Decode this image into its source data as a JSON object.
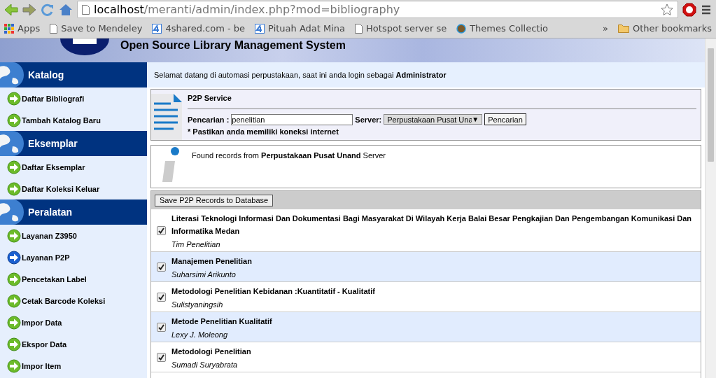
{
  "browser": {
    "url": {
      "host": "localhost",
      "path": "/meranti/admin/index.php?mod=bibliography"
    },
    "bookmarks": [
      {
        "label": "Apps",
        "kind": "apps"
      },
      {
        "label": "Save to Mendeley",
        "kind": "page"
      },
      {
        "label": "4shared.com - be",
        "kind": "four"
      },
      {
        "label": "Pituah Adat Mina",
        "kind": "four"
      },
      {
        "label": "Hotspot server se",
        "kind": "page"
      },
      {
        "label": "Themes Collectio",
        "kind": "theme"
      }
    ],
    "more": "»",
    "other_bookmarks": "Other bookmarks"
  },
  "header": {
    "title": "Open Source Library Management System"
  },
  "sidebar": [
    {
      "title": "Katalog",
      "items": [
        {
          "label": "Daftar Bibliografi",
          "selected": false
        },
        {
          "label": "Tambah Katalog Baru",
          "selected": false
        }
      ]
    },
    {
      "title": "Eksemplar",
      "items": [
        {
          "label": "Daftar Eksemplar",
          "selected": false
        },
        {
          "label": "Daftar Koleksi Keluar",
          "selected": false
        }
      ]
    },
    {
      "title": "Peralatan",
      "items": [
        {
          "label": "Layanan Z3950",
          "selected": false
        },
        {
          "label": "Layanan P2P",
          "selected": true
        },
        {
          "label": "Pencetakan Label",
          "selected": false
        },
        {
          "label": "Cetak Barcode Koleksi",
          "selected": false
        },
        {
          "label": "Impor Data",
          "selected": false
        },
        {
          "label": "Ekspor Data",
          "selected": false
        },
        {
          "label": "Impor Item",
          "selected": false
        }
      ]
    }
  ],
  "welcome": "Selamat datang di automasi perpustakaan, saat ini anda login sebagai **Administrator**",
  "p2p": {
    "title": "P2P Service",
    "search_label": "Pencarian :",
    "search_value": "penelitian",
    "server_label": "Server:",
    "server_value": "Perpustakaan Pusat Una",
    "dropdown_arrow": "▼",
    "search_button": "Pencarian",
    "note": "* Pastikan anda memiliki koneksi internet"
  },
  "info": "Found records from **Perpustakaan Pusat Unand** Server",
  "save_button": "Save P2P Records to Database",
  "records": [
    {
      "title": "Literasi Teknologi Informasi Dan Dokumentasi Bagi Masyarakat Di Wilayah Kerja Balai Besar Pengkajian Dan Pengembangan Komunikasi Dan Informatika Medan",
      "author": "Tim Penelitian",
      "checked": true
    },
    {
      "title": "Manajemen Penelitian",
      "author": "Suharsimi Arikunto",
      "checked": true
    },
    {
      "title": "Metodologi Penelitian Kebidanan :Kuantitatif - Kualitatif",
      "author": "Sulistyaningsih",
      "checked": true
    },
    {
      "title": "Metode Penelitian Kualitatif",
      "author": "Lexy J. Moleong",
      "checked": true
    },
    {
      "title": "Metodologi Penelitian",
      "author": "Sumadi Suryabrata",
      "checked": true
    }
  ]
}
